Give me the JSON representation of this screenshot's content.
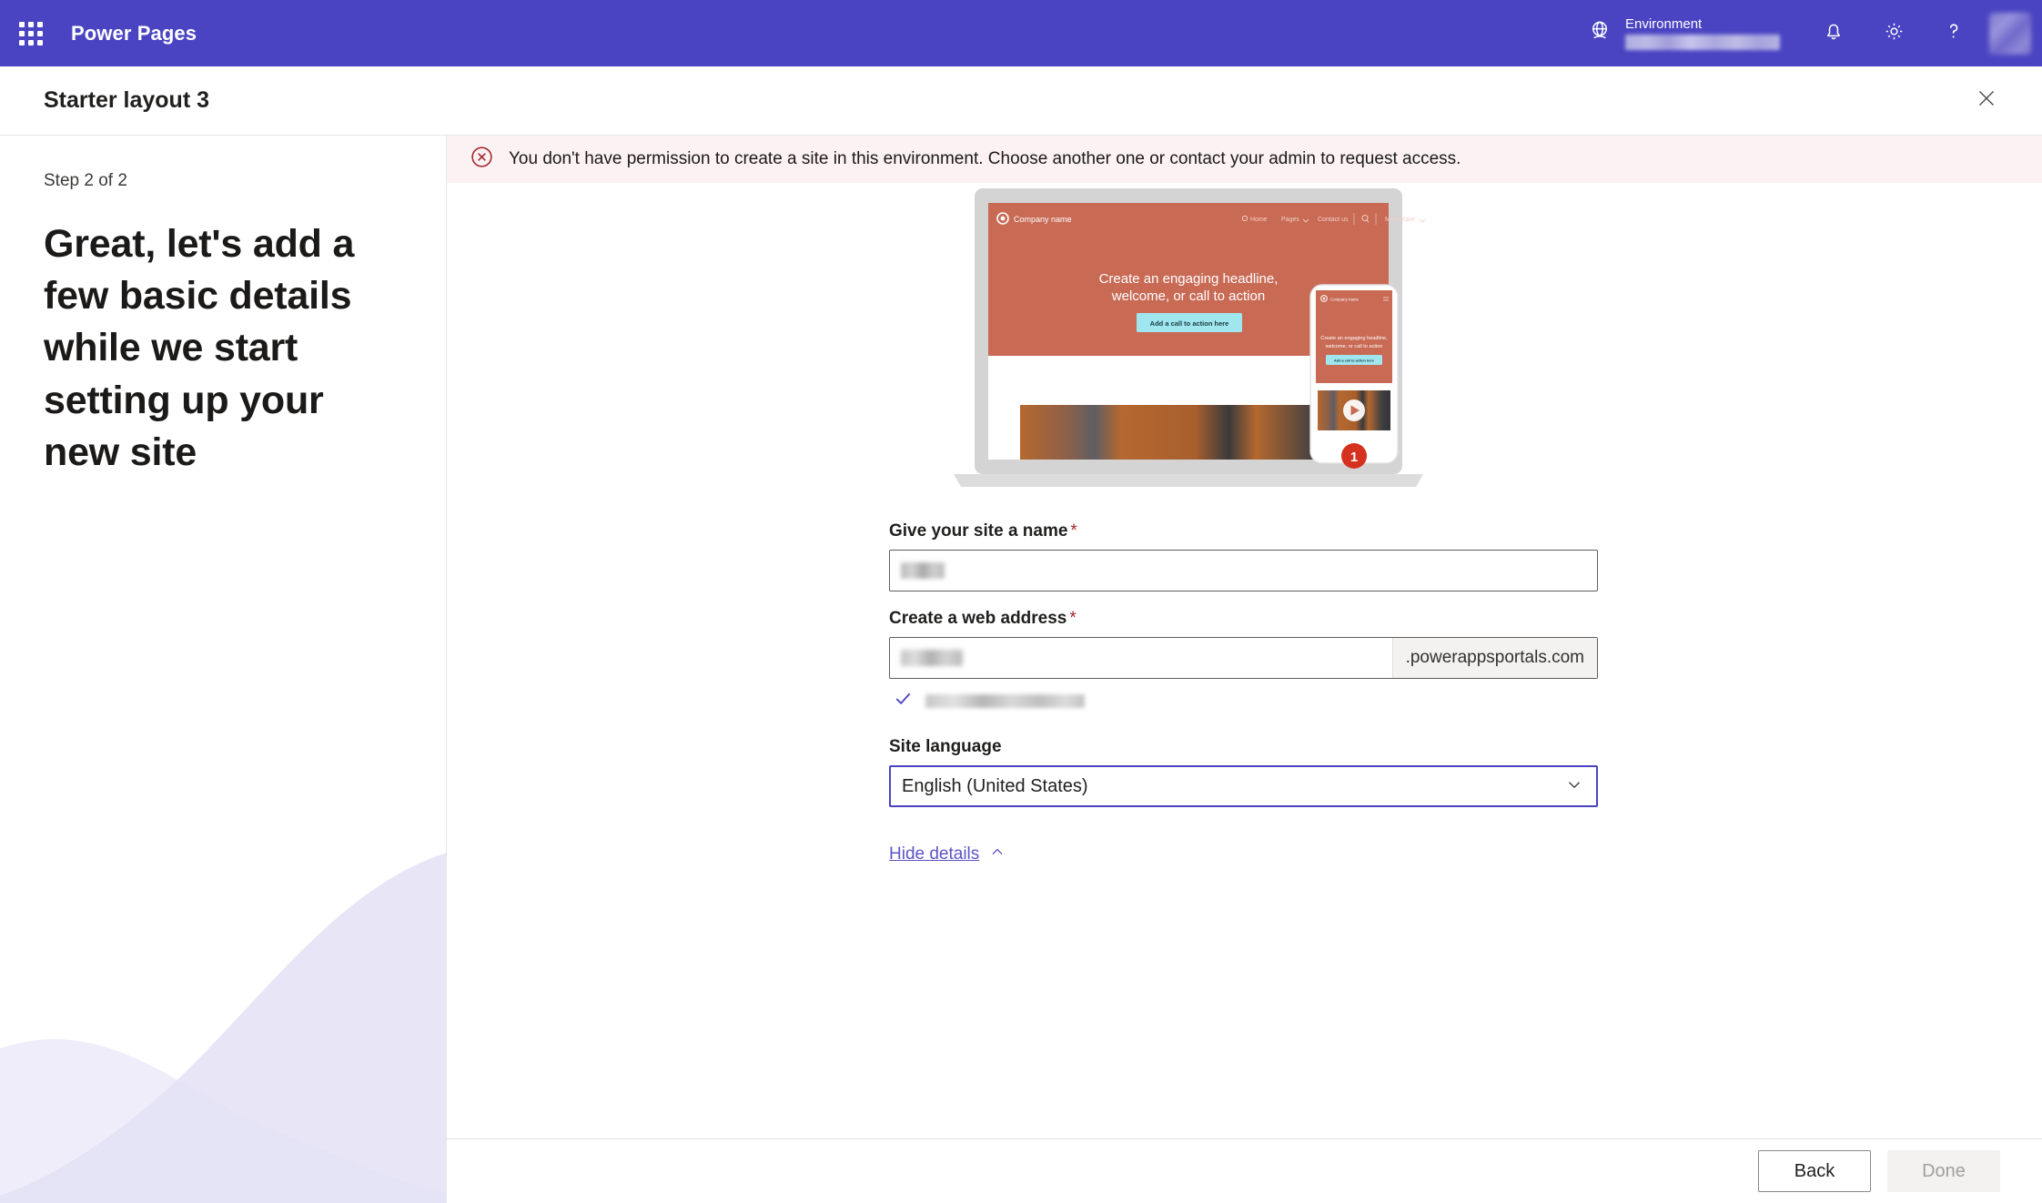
{
  "suite": {
    "app_name": "Power Pages",
    "waffle_icon": "app-launcher-icon",
    "environment_label": "Environment",
    "environment_value": "",
    "globe_icon": "environment-globe-icon",
    "notification_icon": "bell-icon",
    "settings_icon": "gear-icon",
    "help_icon": "question-mark-icon",
    "avatar_icon": "user-avatar",
    "brand_color": "#4a44c2"
  },
  "title_bar": {
    "title": "Starter layout 3",
    "close_icon": "close-icon"
  },
  "banner": {
    "icon": "error-circle-x-icon",
    "message": "You don't have permission to create a site in this environment. Choose another one or contact your admin to request access.",
    "background_color": "#fdf2f3",
    "icon_color": "#a4262c"
  },
  "left_panel": {
    "step": "Step 2 of 2",
    "heading": "Great, let's add a few basic details while we start setting up your new site",
    "wave_color": "#e6e3f7"
  },
  "preview": {
    "site_logo_label": "Company name",
    "nav_items": [
      "Home",
      "Pages",
      "Contact us",
      "More Kare"
    ],
    "search_icon": "search-icon",
    "hero_line1": "Create an engaging headline,",
    "hero_line2": "welcome, or call to action",
    "cta_label": "Add a call to action here",
    "hero_color": "#c96a55",
    "cta_color": "#9fe6ee",
    "badge_number": "1",
    "play_icon": "play-icon"
  },
  "form": {
    "site_name": {
      "label": "Give your site a name",
      "required_mark": "*",
      "value": ""
    },
    "web_address": {
      "label": "Create a web address",
      "required_mark": "*",
      "value": "",
      "suffix": ".powerappsportals.com",
      "validation_icon": "checkmark-icon",
      "validation_text": ""
    },
    "site_language": {
      "label": "Site language",
      "selected": "English (United States)",
      "chevron_icon": "chevron-down-icon",
      "options": [
        "English (United States)"
      ]
    },
    "details_toggle": {
      "label": "Hide details",
      "icon": "chevron-up-icon"
    }
  },
  "footer": {
    "back_label": "Back",
    "done_label": "Done",
    "done_disabled": true
  }
}
